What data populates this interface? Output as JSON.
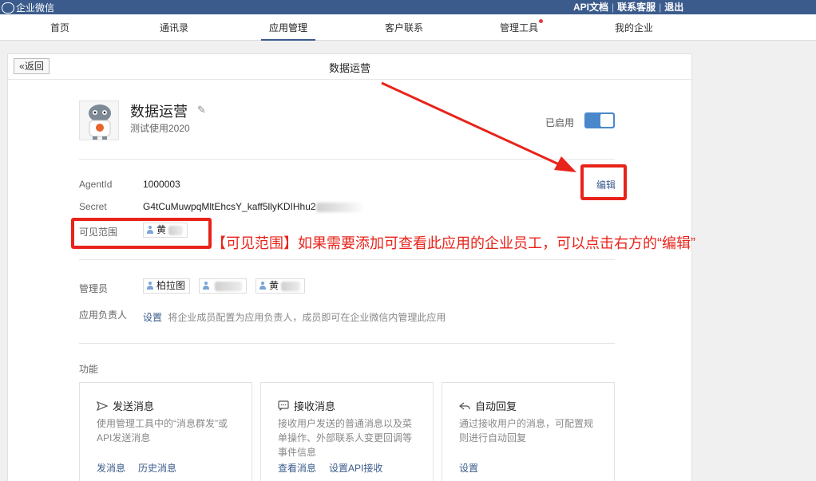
{
  "topbar": {
    "brand": "企业微信",
    "links": [
      "API文档",
      "联系客服",
      "退出"
    ]
  },
  "nav": {
    "items": [
      "首页",
      "通讯录",
      "应用管理",
      "客户联系",
      "管理工具",
      "我的企业"
    ],
    "active": "应用管理"
  },
  "panel": {
    "back_label": "«返回",
    "title": "数据运营"
  },
  "app": {
    "name": "数据运营",
    "desc": "测试使用2020",
    "status_label": "已启用",
    "enabled": true
  },
  "details": {
    "agentid_label": "AgentId",
    "agentid_value": "1000003",
    "secret_label": "Secret",
    "secret_value": "G4tCuMuwpqMltEhcsY_kaff5llyKDIHhu2",
    "edit_label": "编辑",
    "scope_label": "可见范围",
    "scope_members": [
      "黄"
    ],
    "admins_label": "管理员",
    "admins": [
      "柏拉图",
      "",
      "黄"
    ],
    "owner_label": "应用负责人",
    "owner_link": "设置",
    "owner_hint": "将企业成员配置为应用负责人，成员即可在企业微信内管理此应用"
  },
  "features": {
    "section_label": "功能",
    "cards": [
      {
        "title": "发送消息",
        "icon": "send-icon",
        "desc": "使用管理工具中的“消息群发”或API发送消息",
        "actions": [
          "发消息",
          "历史消息"
        ]
      },
      {
        "title": "接收消息",
        "icon": "chat-icon",
        "desc": "接收用户发送的普通消息以及菜单操作、外部联系人变更回调等事件信息",
        "actions": [
          "查看消息",
          "设置API接收"
        ]
      },
      {
        "title": "自动回复",
        "icon": "reply-icon",
        "desc": "通过接收用户的消息，可配置规则进行自动回复",
        "actions": [
          "设置"
        ]
      }
    ]
  },
  "annotation": {
    "text": "【可见范围】如果需要添加可查看此应用的企业员工，可以点击右方的“编辑”",
    "color": "#e8231a"
  }
}
